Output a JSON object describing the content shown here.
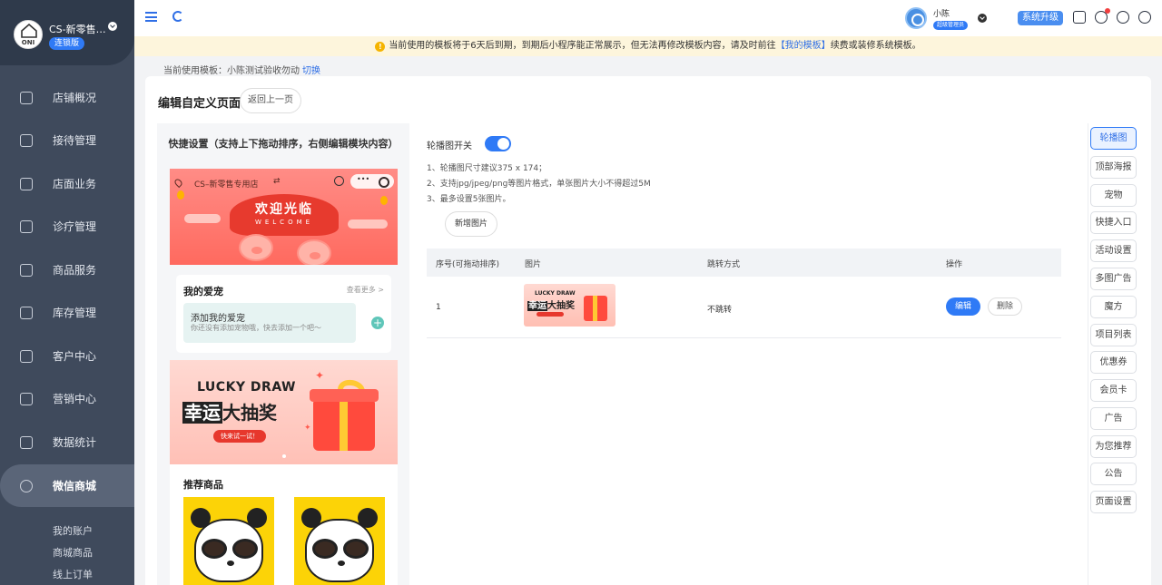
{
  "sidebar": {
    "logo_text": "ONI PET",
    "shop_name": "CS-新零售专...",
    "tag": "连锁版",
    "items": [
      {
        "label": "店铺概况"
      },
      {
        "label": "接待管理"
      },
      {
        "label": "店面业务"
      },
      {
        "label": "诊疗管理"
      },
      {
        "label": "商品服务"
      },
      {
        "label": "库存管理"
      },
      {
        "label": "客户中心"
      },
      {
        "label": "营销中心"
      },
      {
        "label": "数据统计"
      },
      {
        "label": "微信商城"
      }
    ],
    "sub_items": [
      {
        "label": "我的账户"
      },
      {
        "label": "商城商品"
      },
      {
        "label": "线上订单"
      }
    ]
  },
  "header": {
    "user_name": "小陈",
    "user_role": "超级管理员",
    "upgrade_label": "系统升级"
  },
  "notice": {
    "text_before": "当前使用的模板将于6天后到期，到期后小程序能正常展示，但无法再修改模板内容，请及时前往",
    "link": "【我的模板】",
    "text_after": "续费或装修系统模板。"
  },
  "template_line": {
    "label": "当前使用模板：小陈测试验收勿动",
    "switch_label": "切换"
  },
  "page": {
    "title": "编辑自定义页面",
    "back_label": "返回上一页"
  },
  "preview": {
    "quick_title": "快捷设置（支持上下拖动排序，右侧编辑模块内容）",
    "shop_name": "CS–新零售专用店",
    "swap_icon": "⇄",
    "welcome_cn": "欢迎光临",
    "welcome_en": "WELCOME",
    "pets_title": "我的爱宠",
    "pets_more": "查看更多 >",
    "pets_add": "添加我的爱宠",
    "pets_sub": "你还没有添加宠物哦，快去添加一个吧～",
    "pets_plus": "+",
    "lucky_en": "LUCKY DRAW",
    "lucky_hl": "幸运",
    "lucky_rest": "大抽奖",
    "lucky_btn": "快来试一试！",
    "recommend_title": "推荐商品"
  },
  "settings": {
    "toggle_label": "轮播图开关",
    "toggle_on": true,
    "rules": [
      "1、轮播图尺寸建议375 x 174；",
      "2、支持jpg/jpeg/png等图片格式，单张图片大小不得超过5M",
      "3、最多设置5张图片。"
    ],
    "add_label": "新增图片"
  },
  "table": {
    "columns": [
      "序号(可拖动排序)",
      "图片",
      "跳转方式",
      "操作"
    ],
    "rows": [
      {
        "index": "1",
        "thumb_en": "LUCKY DRAW",
        "thumb_hl": "幸运",
        "thumb_rest": "大抽奖",
        "jump": "不跳转",
        "edit": "编辑",
        "delete": "删除"
      }
    ]
  },
  "right_nav": {
    "active": "轮播图",
    "items": [
      {
        "label": "轮播图"
      },
      {
        "label": "顶部海报"
      },
      {
        "label": "宠物"
      },
      {
        "label": "快捷入口"
      },
      {
        "label": "活动设置"
      },
      {
        "label": "多图广告"
      },
      {
        "label": "魔方"
      },
      {
        "label": "项目列表"
      },
      {
        "label": "优惠券"
      },
      {
        "label": "会员卡"
      },
      {
        "label": "广告"
      },
      {
        "label": "为您推荐"
      },
      {
        "label": "公告"
      },
      {
        "label": "页面设置"
      }
    ]
  },
  "colors": {
    "accent": "#2f7af6",
    "sidebar": "#3f4a5c",
    "notice_bg": "#fdf5dc"
  }
}
